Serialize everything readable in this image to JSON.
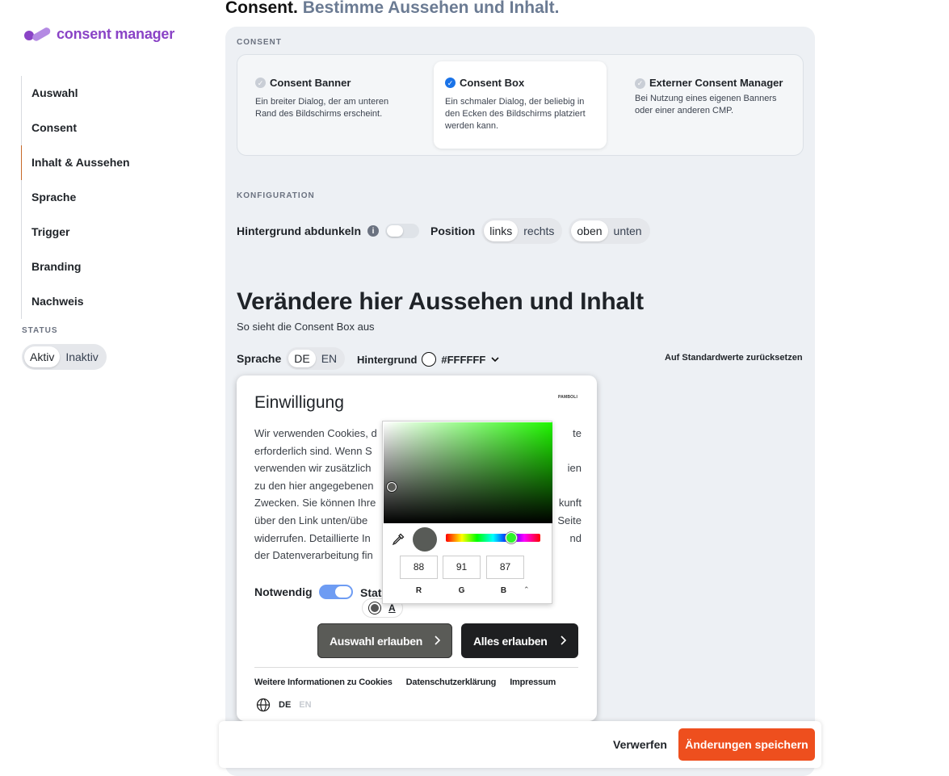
{
  "brand": {
    "name": "consent manager",
    "color": "#8a43c6"
  },
  "page": {
    "title_main": "Consent.",
    "title_sub": "Bestimme Aussehen und Inhalt."
  },
  "nav": {
    "items": [
      {
        "label": "Auswahl"
      },
      {
        "label": "Consent"
      },
      {
        "label": "Inhalt & Aussehen"
      },
      {
        "label": "Sprache"
      },
      {
        "label": "Trigger"
      },
      {
        "label": "Branding"
      },
      {
        "label": "Nachweis"
      }
    ],
    "active": "Inhalt & Aussehen"
  },
  "status": {
    "label": "STATUS",
    "options": [
      "Aktiv",
      "Inaktiv"
    ],
    "selected": "Aktiv"
  },
  "consent": {
    "label": "CONSENT",
    "options": [
      {
        "title": "Consent Banner",
        "desc": "Ein breiter Dialog, der am unteren Rand des Bildschirms erscheint."
      },
      {
        "title": "Consent Box",
        "desc": "Ein schmaler Dialog, der beliebig in den Ecken des Bildschirms platziert werden kann."
      },
      {
        "title": "Externer Consent Manager",
        "desc": "Bei Nutzung eines eigenen Banners oder einer anderen CMP."
      }
    ],
    "selected": "Consent Box"
  },
  "config": {
    "label": "KONFIGURATION",
    "dim_label": "Hintergrund abdunkeln",
    "dim_on": false,
    "position_label": "Position",
    "horizontal": [
      "links",
      "rechts"
    ],
    "horizontal_selected": "links",
    "vertical": [
      "oben",
      "unten"
    ],
    "vertical_selected": "oben"
  },
  "appearance": {
    "heading": "Verändere hier Aussehen und Inhalt",
    "sub": "So sieht die Consent Box aus",
    "lang_label": "Sprache",
    "langs": [
      "DE",
      "EN"
    ],
    "lang_selected": "DE",
    "bg_label": "Hintergrund",
    "bg_value": "#FFFFFF",
    "reset": "Auf Standardwerte zurücksetzen"
  },
  "preview": {
    "title": "Einwilligung",
    "logo_text": "PAMBOLI",
    "lines": [
      "Wir verwenden Cookies, d",
      "erforderlich sind. Wenn S",
      "verwenden wir zusätzlich",
      "zu den hier angegebenen",
      "Zwecken. Sie können Ihre",
      "über den Link unten/übe",
      "widerrufen. Detaillierte In",
      "der Datenverarbeitung fin"
    ],
    "lines_right": [
      "te",
      "",
      "ien",
      "",
      "kunft",
      "Seite",
      "nd",
      ""
    ],
    "notwendig": "Notwendig",
    "stat_fragment": "Stat",
    "mini_letter": "A",
    "btn_select": "Auswahl erlauben",
    "btn_all": "Alles erlauben",
    "links": [
      "Weitere Informationen zu Cookies",
      "Datenschutzerklärung",
      "Impressum"
    ],
    "lang_active": "DE",
    "lang_inactive": "EN"
  },
  "picker": {
    "r": "88",
    "g": "91",
    "b": "87",
    "r_label": "R",
    "g_label": "G",
    "b_label": "B",
    "current_color": "#585b57"
  },
  "actions": {
    "discard": "Verwerfen",
    "save": "Änderungen speichern",
    "save_color": "#ee4f1e"
  }
}
